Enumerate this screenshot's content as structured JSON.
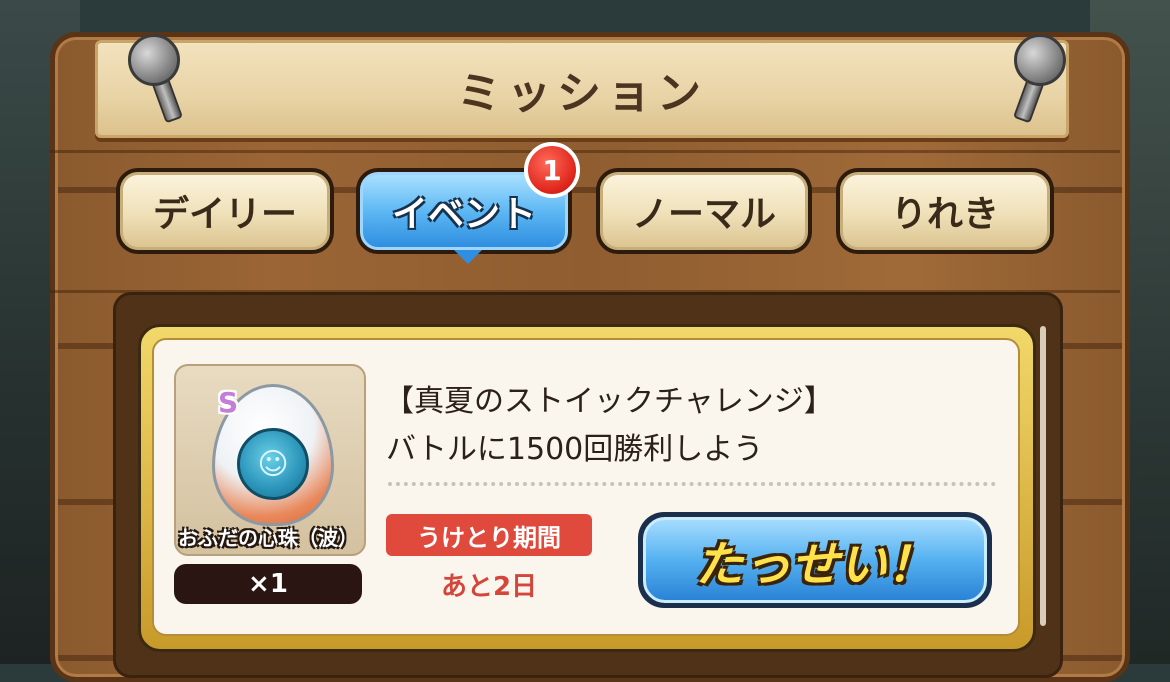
{
  "screen": {
    "title": "ミッション"
  },
  "tabs": [
    {
      "label": "デイリー",
      "active": false
    },
    {
      "label": "イベント",
      "active": true,
      "badge": "1"
    },
    {
      "label": "ノーマル",
      "active": false
    },
    {
      "label": "りれき",
      "active": false
    }
  ],
  "mission": {
    "title": "【真夏のストイックチャレンジ】",
    "description": "バトルに1500回勝利しよう",
    "reward": {
      "rank": "S",
      "name": "おふだの心珠（波）",
      "quantity": "×1",
      "icon": "spirit-orb-icon"
    },
    "period_label": "うけとり期間",
    "period_value": "あと2日",
    "achieve_label": "たっせい！"
  },
  "colors": {
    "active_tab": "#5db8f3",
    "badge": "#e0281e",
    "period_label_bg": "#e04a3c",
    "achieve_text": "#ffe24a"
  }
}
